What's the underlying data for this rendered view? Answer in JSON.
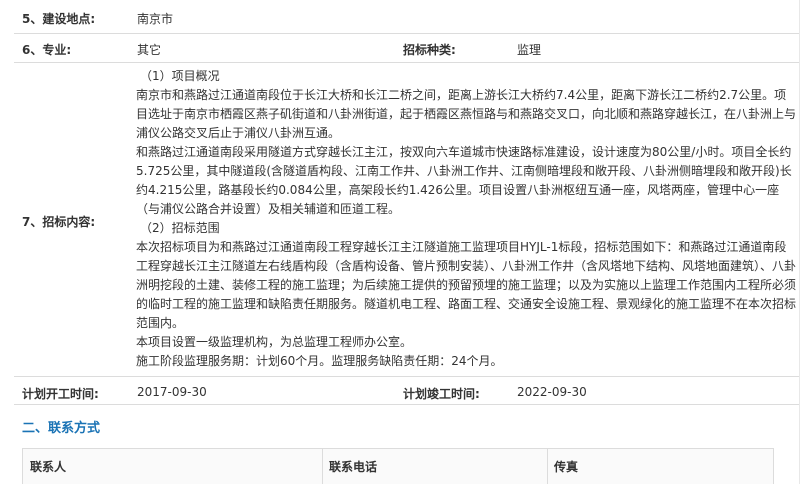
{
  "rows": {
    "r5": {
      "label": "5、建设地点:",
      "value": "南京市"
    },
    "r6": {
      "label": "6、专业:",
      "value": "其它",
      "label2": "招标种类:",
      "value2": "监理"
    },
    "r7": {
      "label": "7、招标内容:",
      "lines": [
        "（1）项目概况",
        "南京市和燕路过江通道南段位于长江大桥和长江二桥之间，距离上游长江大桥约7.4公里，距离下游长江二桥约2.7公里。项目选址于南京市栖霞区燕子矶街道和八卦洲街道，起于栖霞区燕恒路与和燕路交叉口，向北顺和燕路穿越长江，在八卦洲上与浦仪公路交叉后止于浦仪八卦洲互通。",
        "和燕路过江通道南段采用隧道方式穿越长江主江，按双向六车道城市快速路标准建设，设计速度为80公里/小时。项目全长约5.725公里，其中隧道段(含隧道盾构段、江南工作井、八卦洲工作井、江南侧暗埋段和敞开段、八卦洲侧暗埋段和敞开段)长约4.215公里，路基段长约0.084公里，高架段长约1.426公里。项目设置八卦洲枢纽互通一座，风塔两座，管理中心一座（与浦仪公路合并设置）及相关辅道和匝道工程。",
        "（2）招标范围",
        "本次招标项目为和燕路过江通道南段工程穿越长江主江隧道施工监理项目HYJL-1标段，招标范围如下：和燕路过江通道南段工程穿越长江主江隧道左右线盾构段（含盾构设备、管片预制安装）、八卦洲工作井（含风塔地下结构、风塔地面建筑）、八卦洲明挖段的土建、装修工程的施工监理；为后续施工提供的预留预埋的施工监理；以及为实施以上监理工作范围内工程所必须的临时工程的施工监理和缺陷责任期服务。隧道机电工程、路面工程、交通安全设施工程、景观绿化的施工监理不在本次招标范围内。",
        "本项目设置一级监理机构，为总监理工程师办公室。",
        "施工阶段监理服务期：计划60个月。监理服务缺陷责任期：24个月。"
      ]
    },
    "rplan": {
      "label": "计划开工时间:",
      "value": "2017-09-30",
      "label2": "计划竣工时间:",
      "value2": "2022-09-30"
    }
  },
  "section": {
    "title": "二、联系方式"
  },
  "contact_table": {
    "headers": [
      "联系人",
      "联系电话",
      "传真"
    ]
  }
}
